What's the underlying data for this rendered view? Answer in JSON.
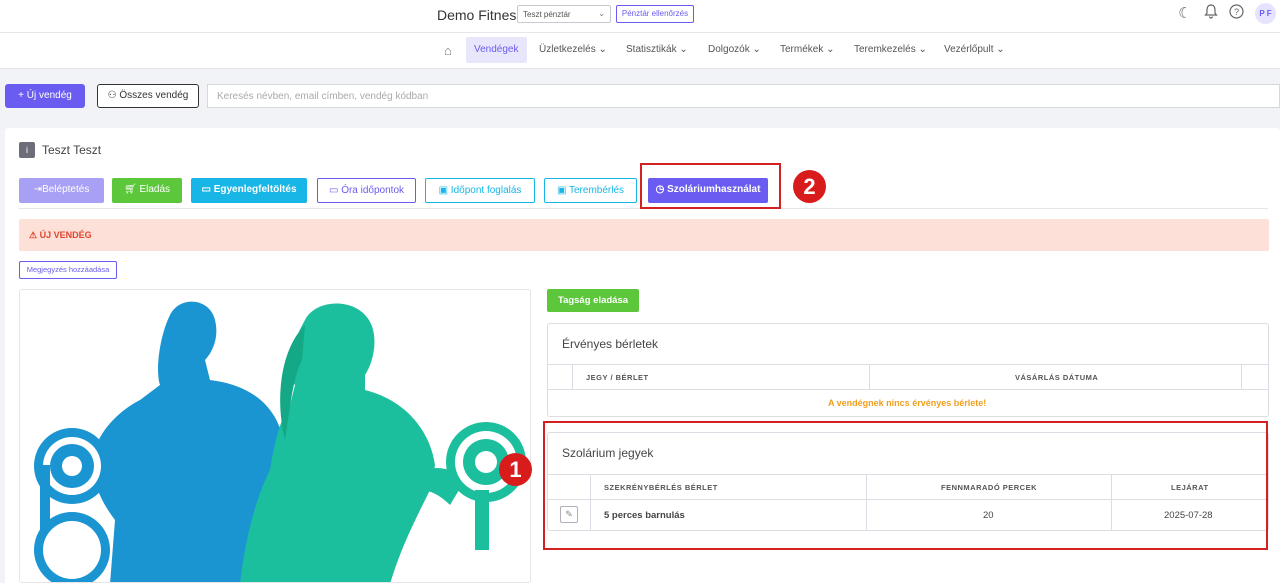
{
  "topbar": {
    "brand": "Demo Fitness",
    "register_select": "Teszt pénztár",
    "register_check": "Pénztár ellenőrzés",
    "avatar_initials": "P F"
  },
  "nav": {
    "items": [
      "Vendégek",
      "Üzletkezelés ⌄",
      "Statisztikák ⌄",
      "Dolgozók ⌄",
      "Termékek ⌄",
      "Teremkezelés ⌄",
      "Vezérlőpult ⌄"
    ]
  },
  "actions": {
    "new_guest": "+ Új vendég",
    "all_guests": "Összes vendég",
    "search_placeholder": "Keresés névben, email címben, vendég kódban"
  },
  "guest": {
    "name": "Teszt Teszt",
    "tabs": {
      "checkin": "Beléptetés",
      "sale": "Eladás",
      "balance": "Egyenlegfeltöltés",
      "class_times": "Óra időpontok",
      "booking": "Időpont foglalás",
      "room_rent": "Terembérlés",
      "solarium": "Szoláriumhasználat"
    },
    "alert": "⚠ ÚJ VENDÉG",
    "add_note": "Megjegyzés hozzáadása"
  },
  "membership": {
    "sell_button": "Tagság eladása",
    "valid_passes": {
      "title": "Érvényes bérletek",
      "headers": [
        "JEGY / BÉRLET",
        "VÁSÁRLÁS DÁTUMA"
      ],
      "empty_message": "A vendégnek nincs érvényes bérlete!"
    },
    "solarium": {
      "title": "Szolárium jegyek",
      "headers": [
        "SZEKRÉNYBÉRLÉS BÉRLET",
        "FENNMARADÓ PERCEK",
        "LEJÁRAT"
      ],
      "row": {
        "name": "5 perces barnulás",
        "minutes": "20",
        "expiry": "2025-07-28"
      }
    }
  },
  "annotations": {
    "badge1": "1",
    "badge2": "2"
  },
  "colors": {
    "primary": "#6a5cf0",
    "green": "#5cc73a",
    "cyan": "#18b6e6",
    "red": "#d81b1b"
  }
}
